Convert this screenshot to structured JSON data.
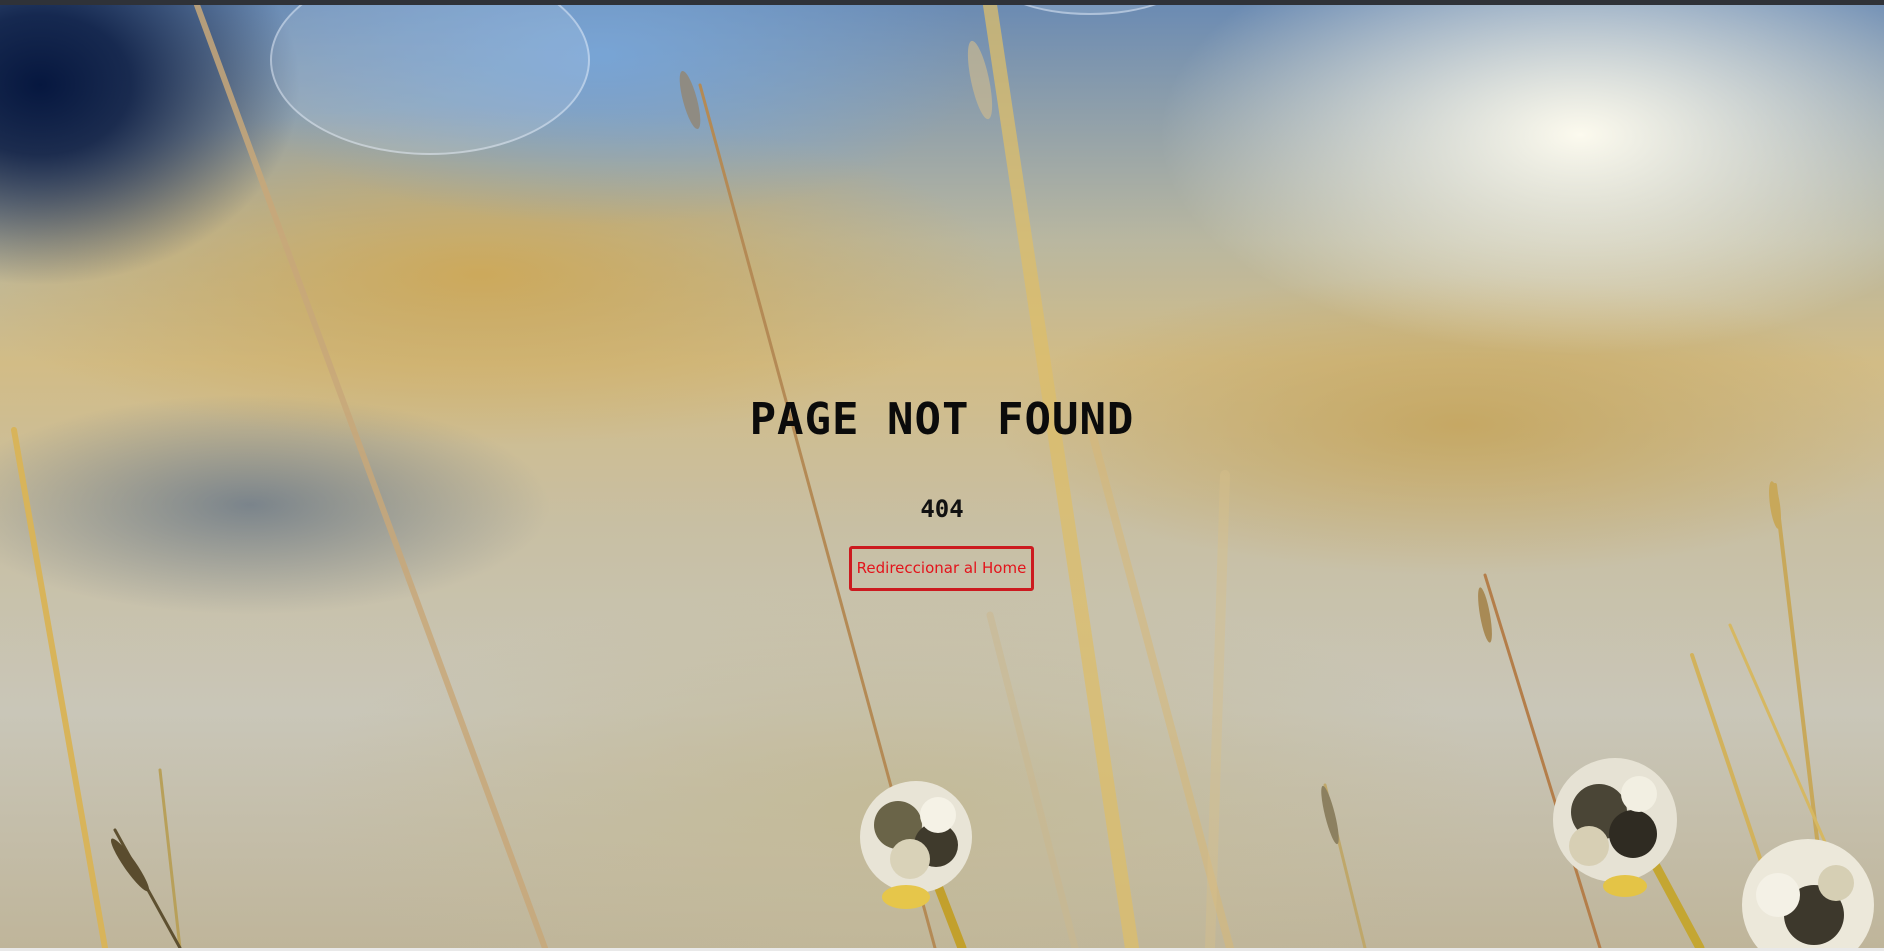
{
  "page": {
    "title": "PAGE NOT FOUND",
    "code": "404",
    "button_label": "Redireccionar al Home"
  },
  "theme": {
    "button_color": "#cc1a1f",
    "button_text_color": "#e3131b",
    "heading_color": "#0b0b0b"
  },
  "background": {
    "subject": "blurred meadow with dry grass stalks and white clover flowers"
  }
}
